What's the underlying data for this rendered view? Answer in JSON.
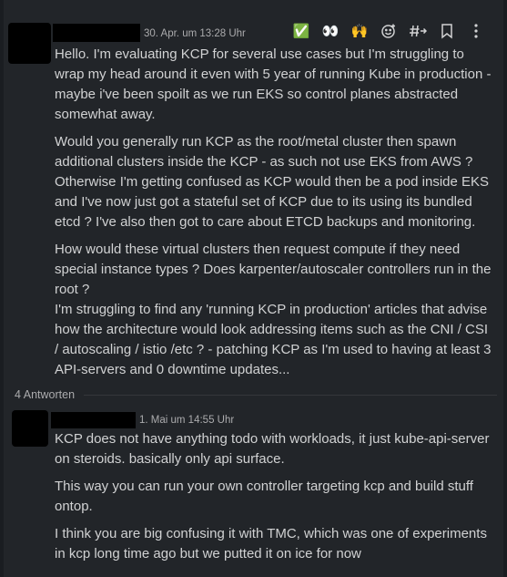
{
  "message": {
    "timestamp": "30. Apr. um 13:28 Uhr",
    "paragraphs": [
      "Hello. I'm evaluating KCP for several use cases but I'm struggling to wrap my head around it even with 5 year of running Kube in production - maybe i've been spoilt as we run EKS so control planes abstracted somewhat away.",
      "Would you generally run KCP as the root/metal cluster then spawn additional clusters inside the KCP - as such not use EKS from AWS ? Otherwise I'm getting confused as KCP would then be a pod inside EKS and I've now just got a stateful set of KCP due to its using its bundled etcd ? I've also then got to care about ETCD backups and monitoring.",
      "How would these virtual clusters then request compute if they need special instance types ? Does karpenter/autoscaler controllers run in the root ?",
      "I'm struggling to find any 'running KCP in production' articles that advise how the architecture would look addressing items such as the CNI / CSI / autoscaling / istio /etc ? - patching KCP as I'm used to having at least 3 API-servers and 0 downtime updates..."
    ]
  },
  "toolbar": {
    "reactions": [
      "✅",
      "👀",
      "🙌"
    ],
    "icons": [
      "add-reaction-icon",
      "hashtag-arrow-icon",
      "bookmark-icon",
      "more-vertical-icon"
    ]
  },
  "thread": {
    "replies_label": "4 Antworten"
  },
  "reply": {
    "timestamp": "1. Mai um 14:55 Uhr",
    "paragraphs": [
      "KCP does not have anything todo with workloads, it just kube-api-server on steroids. basically only api surface.",
      "This way you can run your own controller targeting kcp and build stuff ontop.",
      "I think you are big confusing it with TMC, which was one of experiments in kcp long time ago but we putted it on ice for now"
    ]
  }
}
